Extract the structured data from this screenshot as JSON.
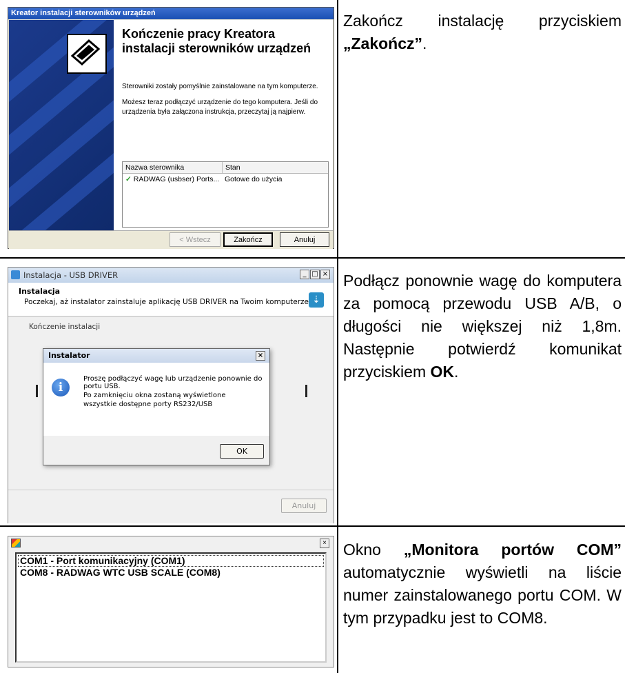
{
  "wizard": {
    "title": "Kreator instalacji sterowników urządzeń",
    "heading": "Kończenie pracy Kreatora instalacji sterowników urządzeń",
    "msg_success": "Sterowniki zostały pomyślnie zainstalowane na tym komputerze.",
    "msg_connect": "Możesz teraz podłączyć urządzenie do tego komputera. Jeśli do urządzenia była załączona instrukcja, przeczytaj ją najpierw.",
    "table_headers": [
      "Nazwa sterownika",
      "Stan"
    ],
    "row_name": "RADWAG (usbser) Ports...",
    "row_status": "Gotowe do użycia",
    "back_label": "< Wstecz",
    "finish_label": "Zakończ",
    "cancel_label": "Anuluj"
  },
  "desc1": {
    "text": "Zakończ instalację przyciskiem",
    "bold": "„Zakończ”",
    "end": "."
  },
  "installer": {
    "title": "Instalacja - USB DRIVER",
    "header_title": "Instalacja",
    "header_sub": "Poczekaj, aż instalator zainstaluje aplikację USB DRIVER na Twoim komputerze.",
    "progress_label": "Kończenie instalacji",
    "cancel_label": "Anuluj",
    "dialog": {
      "title": "Instalator",
      "line1": "Proszę podłączyć wagę lub urządzenie ponownie do portu USB.",
      "line2": "Po zamknięciu okna zostaną wyświetlone wszystkie dostępne porty RS232/USB",
      "ok_label": "OK"
    }
  },
  "desc2": {
    "text": "Podłącz ponownie wagę do komputera za pomocą przewodu USB A/B, o długości nie większej niż 1,8m. Następnie potwierdź komunikat przyciskiem",
    "bold": "OK",
    "end": "."
  },
  "monitor": {
    "ports": [
      "COM1 - Port komunikacyjny (COM1)",
      "COM8 - RADWAG WTC USB SCALE (COM8)"
    ]
  },
  "desc3": {
    "pre": "Okno",
    "bold": "„Monitora portów COM”",
    "text": "automatycznie wyświetli na liście numer zainstalowanego portu COM. W tym przypadku jest to COM8."
  }
}
